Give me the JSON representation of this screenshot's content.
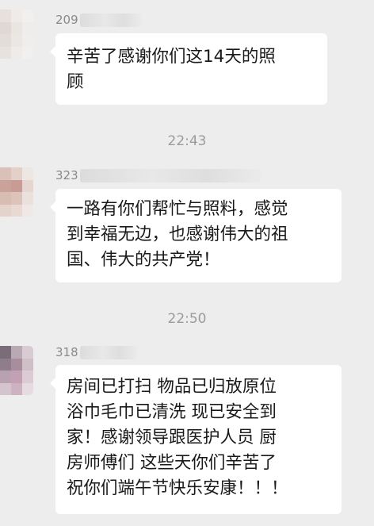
{
  "chat": {
    "messages": [
      {
        "sender_id": "209",
        "lines": [
          "辛苦了感谢你们这14天的照",
          "顾"
        ]
      },
      {
        "sender_id": "323",
        "lines": [
          "一路有你们帮忙与照料，感觉",
          "到幸福无边，也感谢伟大的祖",
          "国、伟大的共产党！"
        ]
      },
      {
        "sender_id": "318",
        "lines": [
          "房间已打扫 物品已归放原位",
          "浴巾毛巾已清洗  现已安全到",
          "家！感谢领导跟医护人员 厨",
          "房师傅们  这些天你们辛苦了",
          "祝你们端午节快乐安康！！！"
        ]
      }
    ],
    "timestamps": [
      "22:43",
      "22:50"
    ]
  },
  "colors": {
    "background": "#ededed",
    "bubble": "#ffffff",
    "text": "#191919",
    "meta_text": "#9b9b9b"
  },
  "avatars": [
    {
      "mosaic": [
        "#e6e1dd",
        "#eeebe8",
        "#f2f0ee",
        "#e0d9d3",
        "#e9e5e1",
        "#efedeb",
        "#e3ddd8",
        "#ebe7e4",
        "#f0eeec",
        "#e7e2de",
        "#eeebe8",
        "#f2f0ee"
      ]
    },
    {
      "mosaic": [
        "#d9c1b8",
        "#e3d0c8",
        "#eee6e2",
        "#c9a39a",
        "#c89c95",
        "#e6d6cf",
        "#d8bdb3",
        "#dcc4ba",
        "#ebe1dc",
        "#e4d3cb",
        "#e8dad3",
        "#f0e8e4"
      ]
    },
    {
      "mosaic": [
        "#7a6d79",
        "#b9a9b2",
        "#d8ccd2",
        "#8f7d8c",
        "#a88d9c",
        "#cfc0c8",
        "#b8a2b0",
        "#c4a0b4",
        "#dccbd4",
        "#d6c4cd",
        "#cdb3c1",
        "#e6dbe1"
      ]
    }
  ]
}
